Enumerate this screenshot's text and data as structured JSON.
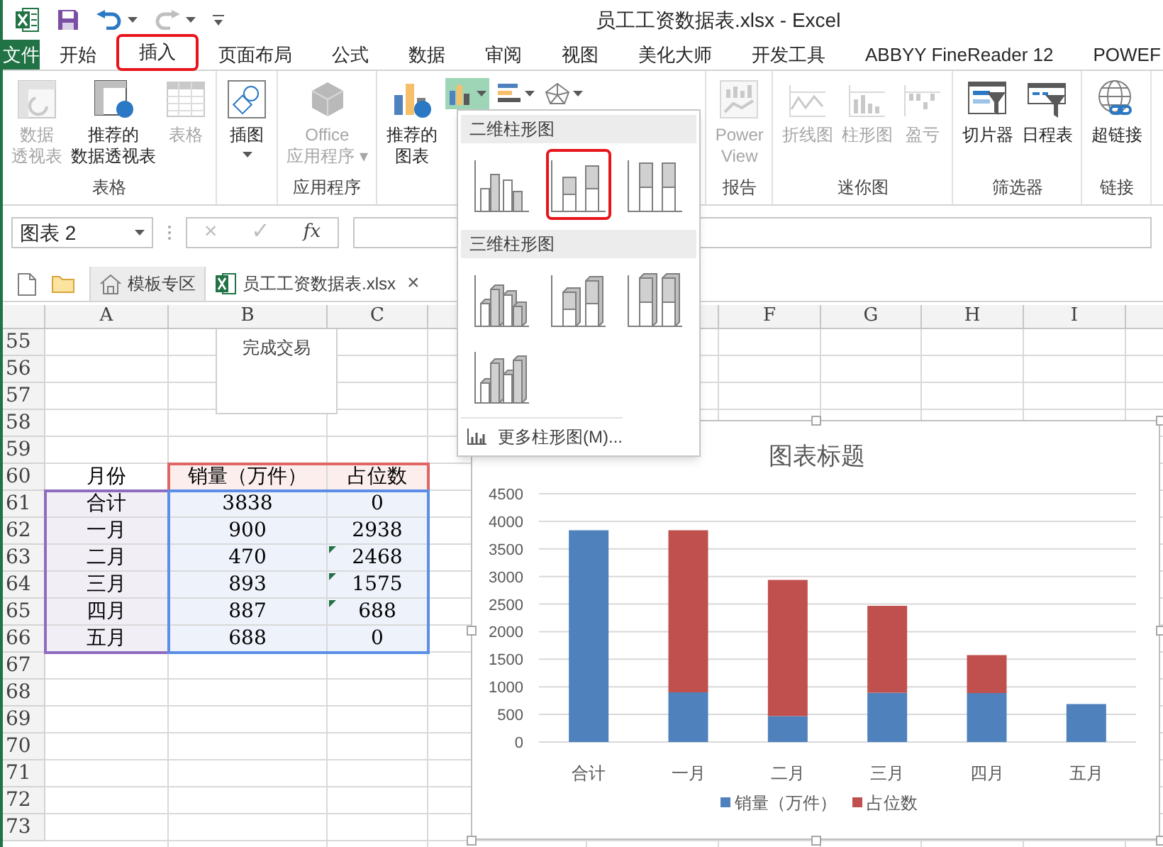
{
  "window": {
    "title": "员工工资数据表.xlsx - Excel"
  },
  "ribbon_tabs": [
    {
      "label": "文件",
      "kind": "file",
      "selected": false
    },
    {
      "label": "开始",
      "kind": "tab",
      "selected": false
    },
    {
      "label": "插入",
      "kind": "tab",
      "selected": true
    },
    {
      "label": "页面布局",
      "kind": "tab",
      "selected": false
    },
    {
      "label": "公式",
      "kind": "tab",
      "selected": false
    },
    {
      "label": "数据",
      "kind": "tab",
      "selected": false
    },
    {
      "label": "审阅",
      "kind": "tab",
      "selected": false
    },
    {
      "label": "视图",
      "kind": "tab",
      "selected": false
    },
    {
      "label": "美化大师",
      "kind": "tab",
      "selected": false
    },
    {
      "label": "开发工具",
      "kind": "tab",
      "selected": false
    },
    {
      "label": "ABBYY FineReader 12",
      "kind": "tab",
      "selected": false
    },
    {
      "label": "POWEF",
      "kind": "tab",
      "selected": false
    }
  ],
  "ribbon_groups": [
    {
      "label": "表格",
      "kind": "standard",
      "buttons": [
        {
          "lines": [
            "数据",
            "透视表"
          ],
          "disabled": true
        },
        {
          "lines": [
            "推荐的",
            "数据透视表"
          ],
          "disabled": false
        },
        {
          "lines": [
            "表格"
          ],
          "disabled": true
        }
      ]
    },
    {
      "kind": "standard",
      "buttons": [
        {
          "lines": [
            "插图"
          ],
          "disabled": false,
          "dropdown": true
        }
      ]
    },
    {
      "label": "应用程序",
      "kind": "standard",
      "buttons": [
        {
          "lines": [
            "Office",
            "应用程序 ▾"
          ],
          "disabled": true
        }
      ]
    },
    {
      "kind": "charts",
      "buttons": [
        {
          "lines": [
            "推荐的",
            "图表"
          ],
          "disabled": false
        }
      ],
      "small_buttons": [
        {
          "active": true
        },
        {
          "active": false
        },
        {
          "active": false
        }
      ]
    },
    {
      "label": "报告",
      "kind": "standard",
      "buttons": [
        {
          "lines": [
            "Power",
            "View"
          ],
          "disabled": true
        }
      ]
    },
    {
      "label": "迷你图",
      "kind": "standard",
      "buttons": [
        {
          "lines": [
            "折线图"
          ],
          "disabled": true
        },
        {
          "lines": [
            "柱形图"
          ],
          "disabled": true
        },
        {
          "lines": [
            "盈亏"
          ],
          "disabled": true
        }
      ]
    },
    {
      "label": "筛选器",
      "kind": "standard",
      "buttons": [
        {
          "lines": [
            "切片器"
          ],
          "disabled": false
        },
        {
          "lines": [
            "日程表"
          ],
          "disabled": false
        }
      ]
    },
    {
      "label": "链接",
      "kind": "standard",
      "buttons": [
        {
          "lines": [
            "超链接"
          ],
          "disabled": false
        }
      ]
    }
  ],
  "name_box": {
    "value": "图表 2"
  },
  "formula_bar": {
    "buttons": [
      "×",
      "✓",
      "fx"
    ]
  },
  "file_tabs": [
    {
      "label": "模板专区",
      "kind": "home",
      "selected": false
    },
    {
      "label": "员工工资数据表.xlsx",
      "kind": "excel",
      "selected": true,
      "close": "×"
    }
  ],
  "columns": [
    "A",
    "B",
    "C",
    "F",
    "G",
    "H",
    "I"
  ],
  "rows": [
    {
      "number": "55"
    },
    {
      "number": "56"
    },
    {
      "number": "57"
    },
    {
      "number": "58"
    },
    {
      "number": "59"
    },
    {
      "number": "60",
      "kind": "header",
      "cells": [
        "月份",
        "销量（万件）",
        "占位数"
      ]
    },
    {
      "number": "61",
      "kind": "data",
      "cells": [
        "合计",
        "3838",
        "0"
      ],
      "error_flag": false
    },
    {
      "number": "62",
      "kind": "data",
      "cells": [
        "一月",
        "900",
        "2938"
      ],
      "error_flag": false
    },
    {
      "number": "63",
      "kind": "data",
      "cells": [
        "二月",
        "470",
        "2468"
      ],
      "error_flag": true
    },
    {
      "number": "64",
      "kind": "data",
      "cells": [
        "三月",
        "893",
        "1575"
      ],
      "error_flag": true
    },
    {
      "number": "65",
      "kind": "data",
      "cells": [
        "四月",
        "887",
        "688"
      ],
      "error_flag": true
    },
    {
      "number": "66",
      "kind": "data",
      "cells": [
        "五月",
        "688",
        "0"
      ],
      "error_flag": false
    },
    {
      "number": "67"
    },
    {
      "number": "68"
    },
    {
      "number": "69"
    },
    {
      "number": "70"
    },
    {
      "number": "71"
    },
    {
      "number": "72"
    },
    {
      "number": "73"
    }
  ],
  "text_box": {
    "text": "完成交易"
  },
  "column_menu": {
    "sections": [
      {
        "title": "二维柱形图",
        "items": [
          {
            "kind": "clustered",
            "selected": false
          },
          {
            "kind": "stacked",
            "selected": true
          },
          {
            "kind": "percent",
            "selected": false
          }
        ]
      },
      {
        "title": "三维柱形图",
        "items": [
          {
            "kind": "clustered3d",
            "selected": false
          },
          {
            "kind": "stacked3d",
            "selected": false
          },
          {
            "kind": "percent3d",
            "selected": false
          },
          {
            "kind": "column3d",
            "selected": false
          }
        ]
      }
    ],
    "more": "更多柱形图(M)..."
  },
  "chart": {
    "chart_data": {
      "type": "bar",
      "title": "图表标题",
      "stacked": true,
      "orientation": "vertical",
      "grid": true,
      "legend": "bottom",
      "categories": [
        "合计",
        "一月",
        "二月",
        "三月",
        "四月",
        "五月"
      ],
      "series": [
        {
          "name": "销量（万件）",
          "color": "#4f81bd",
          "values": [
            3838,
            900,
            470,
            893,
            887,
            688
          ]
        },
        {
          "name": "占位数",
          "color": "#c0504d",
          "values": [
            0,
            2938,
            2468,
            1575,
            688,
            0
          ]
        }
      ],
      "ylim": [
        0,
        4500
      ],
      "yticks": [
        0,
        500,
        1000,
        1500,
        2000,
        2500,
        3000,
        3500,
        4000,
        4500
      ]
    }
  }
}
